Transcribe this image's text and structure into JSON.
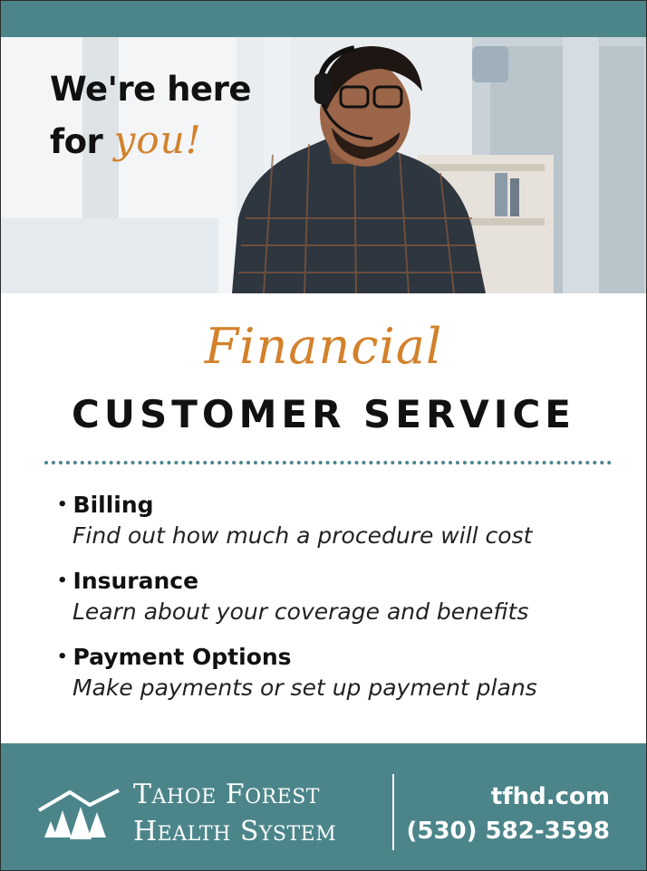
{
  "headline": {
    "line1": "We're here",
    "line2_prefix": "for",
    "line2_accent": "you!"
  },
  "title": {
    "script": "Financial",
    "main": "CUSTOMER SERVICE"
  },
  "services": [
    {
      "bullet": "•",
      "title": "Billing",
      "description": "Find out how much a procedure will cost"
    },
    {
      "bullet": "•",
      "title": "Insurance",
      "description": "Learn about your coverage and benefits"
    },
    {
      "bullet": "•",
      "title": "Payment Options",
      "description": "Make payments or set up payment plans"
    }
  ],
  "footer": {
    "org_line1_cap1": "T",
    "org_line1_rest1": "AHOE",
    "org_line1_cap2": "F",
    "org_line1_rest2": "OREST",
    "org_line2_cap1": "H",
    "org_line2_rest1": "EALTH",
    "org_line2_cap2": "S",
    "org_line2_rest2": "YSTEM",
    "website": "tfhd.com",
    "phone": "(530) 582-3598",
    "logo_icon": "mountain-trees-icon"
  },
  "colors": {
    "teal": "#4b858a",
    "accent_orange": "#d3812b",
    "text_dark": "#111111"
  }
}
